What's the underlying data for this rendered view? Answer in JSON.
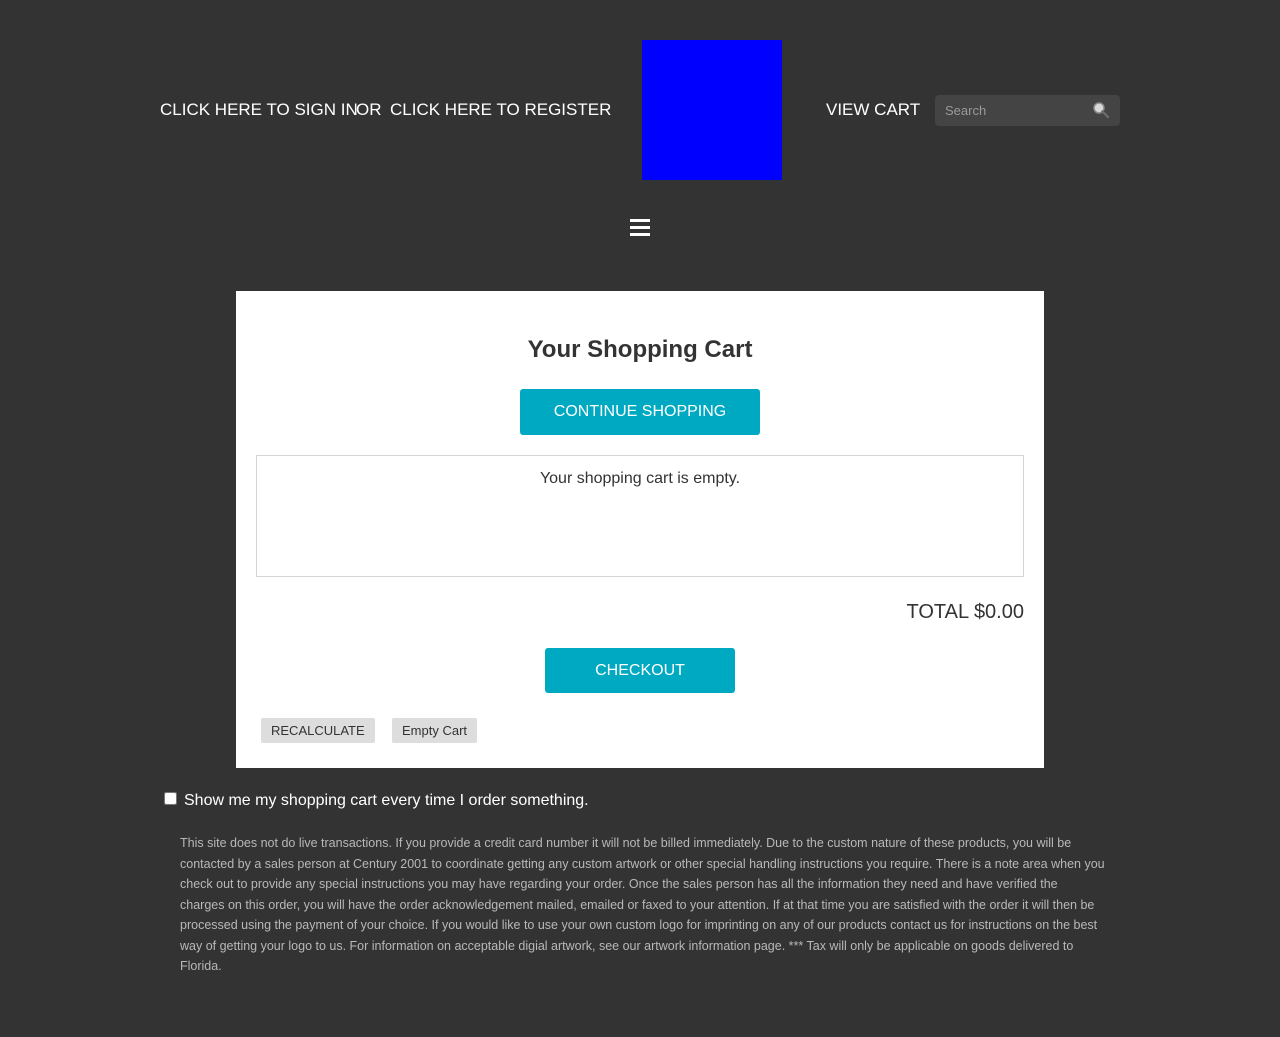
{
  "header": {
    "sign_in_label": "CLICK HERE TO SIGN IN",
    "or_label": "OR",
    "register_label": "CLICK HERE TO REGISTER",
    "view_cart_label": "VIEW CART",
    "search_placeholder": "Search",
    "search_icon": "magnifier-icon",
    "logo_color": "#0000ff",
    "menu_icon": "hamburger-icon"
  },
  "cart": {
    "title": "Your Shopping Cart",
    "continue_label": "CONTINUE SHOPPING",
    "empty_message": "Your shopping cart is empty.",
    "total_label": "TOTAL $0.00",
    "checkout_label": "CHECKOUT",
    "recalculate_label": "RECALCULATE",
    "empty_cart_label": "Empty Cart"
  },
  "footer": {
    "show_cart_label": "Show me my shopping cart every time I order something.",
    "show_cart_checked": false,
    "disclaimer": "This site does not do live transactions. If you provide a credit card number it will not be billed immediately. Due to the custom nature of these products, you will be contacted by a sales person at Century 2001 to coordinate getting any custom artwork or other special handling instructions you require. There is a note area when you check out to provide any special instructions you may have regarding your order. Once the sales person has all the information they need and have verified the charges on this order, you will have the order acknowledgement mailed, emailed or faxed to your attention. If at that time you are satisfied with the order it will then be processed using the payment of your choice. If you would like to use your own custom logo for imprinting on any of our products contact us for instructions on the best way of getting your logo to us. For information on acceptable digial artwork, see our artwork information page. *** Tax will only be applicable on goods delivered to Florida."
  },
  "colors": {
    "background": "#333333",
    "accent": "#00a9c2",
    "card": "#ffffff"
  }
}
